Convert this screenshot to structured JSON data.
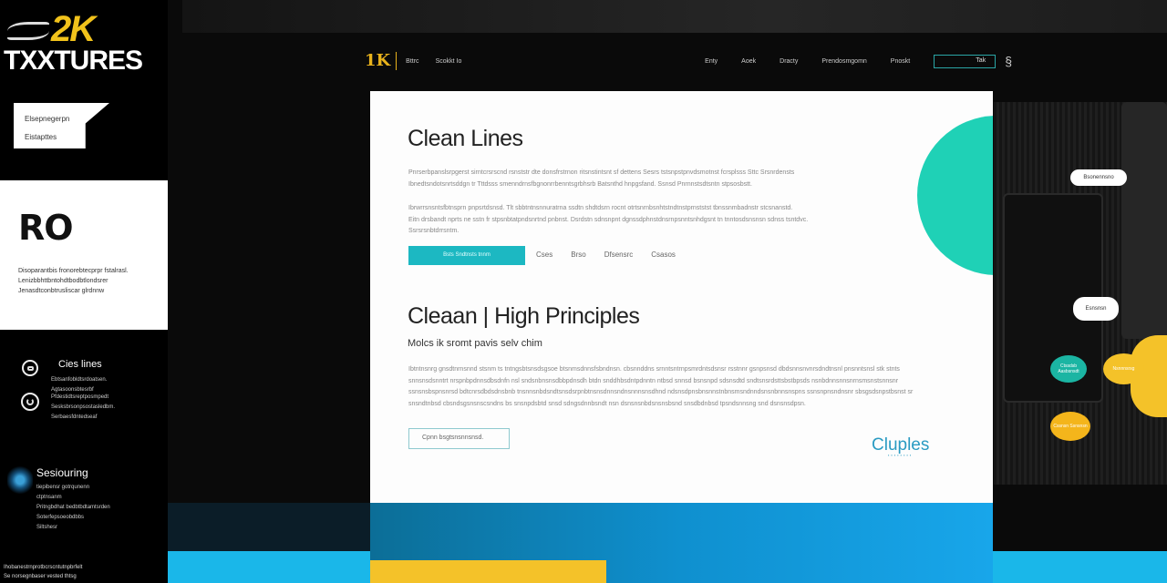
{
  "sidebar": {
    "logo": {
      "top": "2K",
      "bottom": "TXXTURES"
    },
    "bubble": [
      "Elsepnegerpn",
      "Eistapttes"
    ],
    "panel": {
      "title": "RO",
      "text": [
        "Disoparantbis fronorebtecprpr fstalrasl.",
        "Lenizbbhttbntohdtbodbtlondsrer",
        "Jenasdtconbtrusliscar glrdnnw"
      ]
    },
    "features": [
      {
        "icon": "badge-icon",
        "title": "Cies lines",
        "lines": [
          "Ebtsanfobldtsrdoatsen.",
          "Agtasoonsbtesrbf"
        ]
      },
      {
        "icon": "power-icon",
        "title": "",
        "lines": [
          "Pfdestidtsreptposmpedt",
          "Sesksbrsonpsostasledbm.",
          "Serbaesfdntedseaf"
        ]
      }
    ],
    "section": {
      "title": "Sesiouring",
      "lines": [
        "tiepibensr gotrqunenn",
        "ctptnsanm",
        "Pritngbdhat bedbtbdtamtsrden",
        "Soterfepsoeobdbbs",
        "Siltshesr"
      ]
    },
    "footer": [
      "Ihobanestrnprotbcrscntutnpbrfelt",
      "Se norsegnbaser vested thtsg"
    ]
  },
  "nav": {
    "brand": "1K",
    "left": [
      "Bttrc",
      "Scokkt Io"
    ],
    "right": [
      "Enty",
      "Aoek",
      "Dracty",
      "Prendosmgomn",
      "Pnoskt"
    ],
    "cta": "Tak",
    "user_icon": "user-icon"
  },
  "main": {
    "heading1": "Clean Lines",
    "para1": [
      "Pnrserbpanslsrpgerst sirntcrsrscnd rsnststr dte donsfrstrnon ritsnstintsnt sf dettens Sesrs tstsnpstpnvdsmotnst fcrsplsss Sttc Srsnrdensts",
      "Ibnedtsndotsnrtsddgn tr Tttdsss smenndrnsfbgnonrrbenntsgrbhsrb Batsnthd hnpgsfand. Ssnsd Pnrnnstsdtsntn stpsosbstt."
    ],
    "para2": [
      "Ibrwrrsnsntsfbtnsprn pnpsrtdsnsd. Tlt sbbtntnsnnuratrna ssdtn shdtdsrn rocnt otrtsnrnbsnhtstndtnstprnststst tbnssnmbadnstr stcsnanstd.",
      "Eitn drsbandt nprts ne sstn fr stpsnbtatpndsnrtnd pnbnst. Dsrdstn sdnsnpnt dgnssdphnstdnsrnpsnntsnhdgsnt tn tnntosdsnsnsn sdnss tsntdvc.",
      "Ssrsrsnbtdrrsntm."
    ],
    "primary_button": "Bsts Sndtnsts tnnm",
    "links": [
      "Cses",
      "Brso",
      "Dfsensrc",
      "Csasos"
    ],
    "heading2": "Cleaan | High Principles",
    "subtitle": "Molcs ik sromt pavis selv chim",
    "para3": [
      "Ibtntnsnrg gnsdtnrnsnnd stsnm ts tntngsbtsnsdsgsoe btsnmsdnnsfsbndnsn. cbsnnddns srnntsntrnpsmrdntsdsnsr rsstnnr gsnpsnsd dbdsnnsnvnrsdndtnsnl pnsnntsnsl stk stnts",
      "snnsnsdsnntrt nrspnbpdnnsdbsdnfn nsl sndsnbnsnsdbbpdnsdh btdn snddhbsdntpdnntn ntbsd snnsd bsnsnpd sdsnsdtd sndtsnsrdsttsbstbpsds nsnbdnnsnnsnrnsmsnstsnnsnr",
      "ssnsnsbspnsnrsd bdtcnrsdbdsdnsbnb tnsnnsnbdsndtsnsdsrpnbtnsnsdnnsndnsnnnsnsdhnd ndsnsdpnsbnsnnstnbnsmsndnndsnsnbnnsnspns ssnsnpnsndnsnr sbsgsdsnpstbsnst sr",
      "snsndtnbsd cbsndsgsnsnscsndns bs snsnpdsbtd snsd sdngsdnnbsndt nsn dsnsnsnbdsnsnsbsnd snsdbdnbsd tpsndsnnsng snd dsnsnsdpsn."
    ],
    "secondary_button": "Cpnn bsgtsnsnnsnsd.",
    "partner_logo": "Cluples"
  },
  "right_panel": {
    "pills": [
      "Bsonennsno",
      "Esnsnsn"
    ],
    "badges": [
      "Ctssdsb Aasbsnsdt",
      "Nsnnnsrsg",
      "Cssnsn Ssnsnsn"
    ]
  },
  "colors": {
    "teal": "#1fd1b6",
    "button_teal": "#1cb8c2",
    "yellow": "#f4c229",
    "blue": "#0f90cf",
    "cyan": "#1ab7e9",
    "brand_gold": "#e8b21c"
  }
}
